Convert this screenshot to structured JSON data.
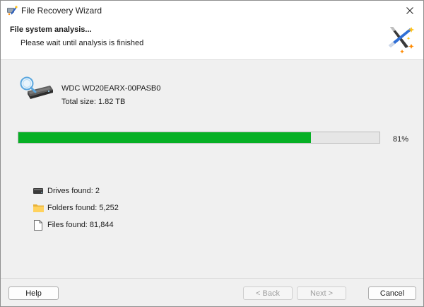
{
  "window": {
    "title": "File Recovery Wizard"
  },
  "header": {
    "title": "File system analysis...",
    "subtitle": "Please wait until analysis is finished"
  },
  "drive": {
    "name": "WDC WD20EARX-00PASB0",
    "size": "Total size: 1.82 TB"
  },
  "progress": {
    "value": 0.81,
    "label": "81%",
    "color": "#06b025"
  },
  "stats": {
    "drives": "Drives found: 2",
    "folders": "Folders found: 5,252",
    "files": "Files found: 81,844"
  },
  "buttons": {
    "help": "Help",
    "back": "< Back",
    "next": "Next >",
    "cancel": "Cancel"
  },
  "icons": {
    "app": "app-wizard-icon",
    "close": "close-icon",
    "wizard": "magic-wand-icon",
    "drive": "hard-drive-search-icon",
    "drives": "drive-icon",
    "folders": "folder-icon",
    "files": "file-icon"
  }
}
